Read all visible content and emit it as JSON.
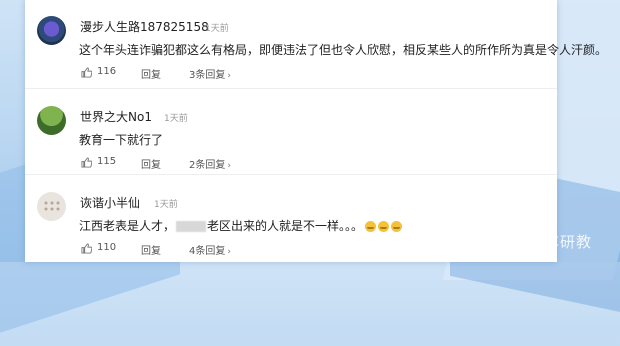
{
  "comments": [
    {
      "username": "漫步人生路187825158",
      "time": "1天前",
      "text": "这个年头连诈骗犯都这么有格局，即便违法了但也令人欣慰，相反某些人的所作所为真是令人汗颜。",
      "likes": "116",
      "reply_label": "回复",
      "replies_label": "3条回复",
      "avatar_icon": "purple-flower-avatar"
    },
    {
      "username": "世界之大No1",
      "time": "1天前",
      "text": "教育一下就行了",
      "likes": "115",
      "reply_label": "回复",
      "replies_label": "2条回复",
      "avatar_icon": "green-landscape-avatar"
    },
    {
      "username": "诙谐小半仙",
      "time": "1天前",
      "text_before": "江西老表是人才，",
      "text_after": "老区出来的人就是不一样。。。",
      "likes": "110",
      "reply_label": "回复",
      "replies_label": "4条回复",
      "avatar_icon": "dot-pattern-avatar",
      "emoji_icon": "grinning-emoji-icon"
    }
  ],
  "watermark": "百家号/汽车研教",
  "colors": {
    "text": "#222222",
    "meta": "#999999",
    "panel": "#ffffff",
    "background": "#b9d6f1"
  }
}
